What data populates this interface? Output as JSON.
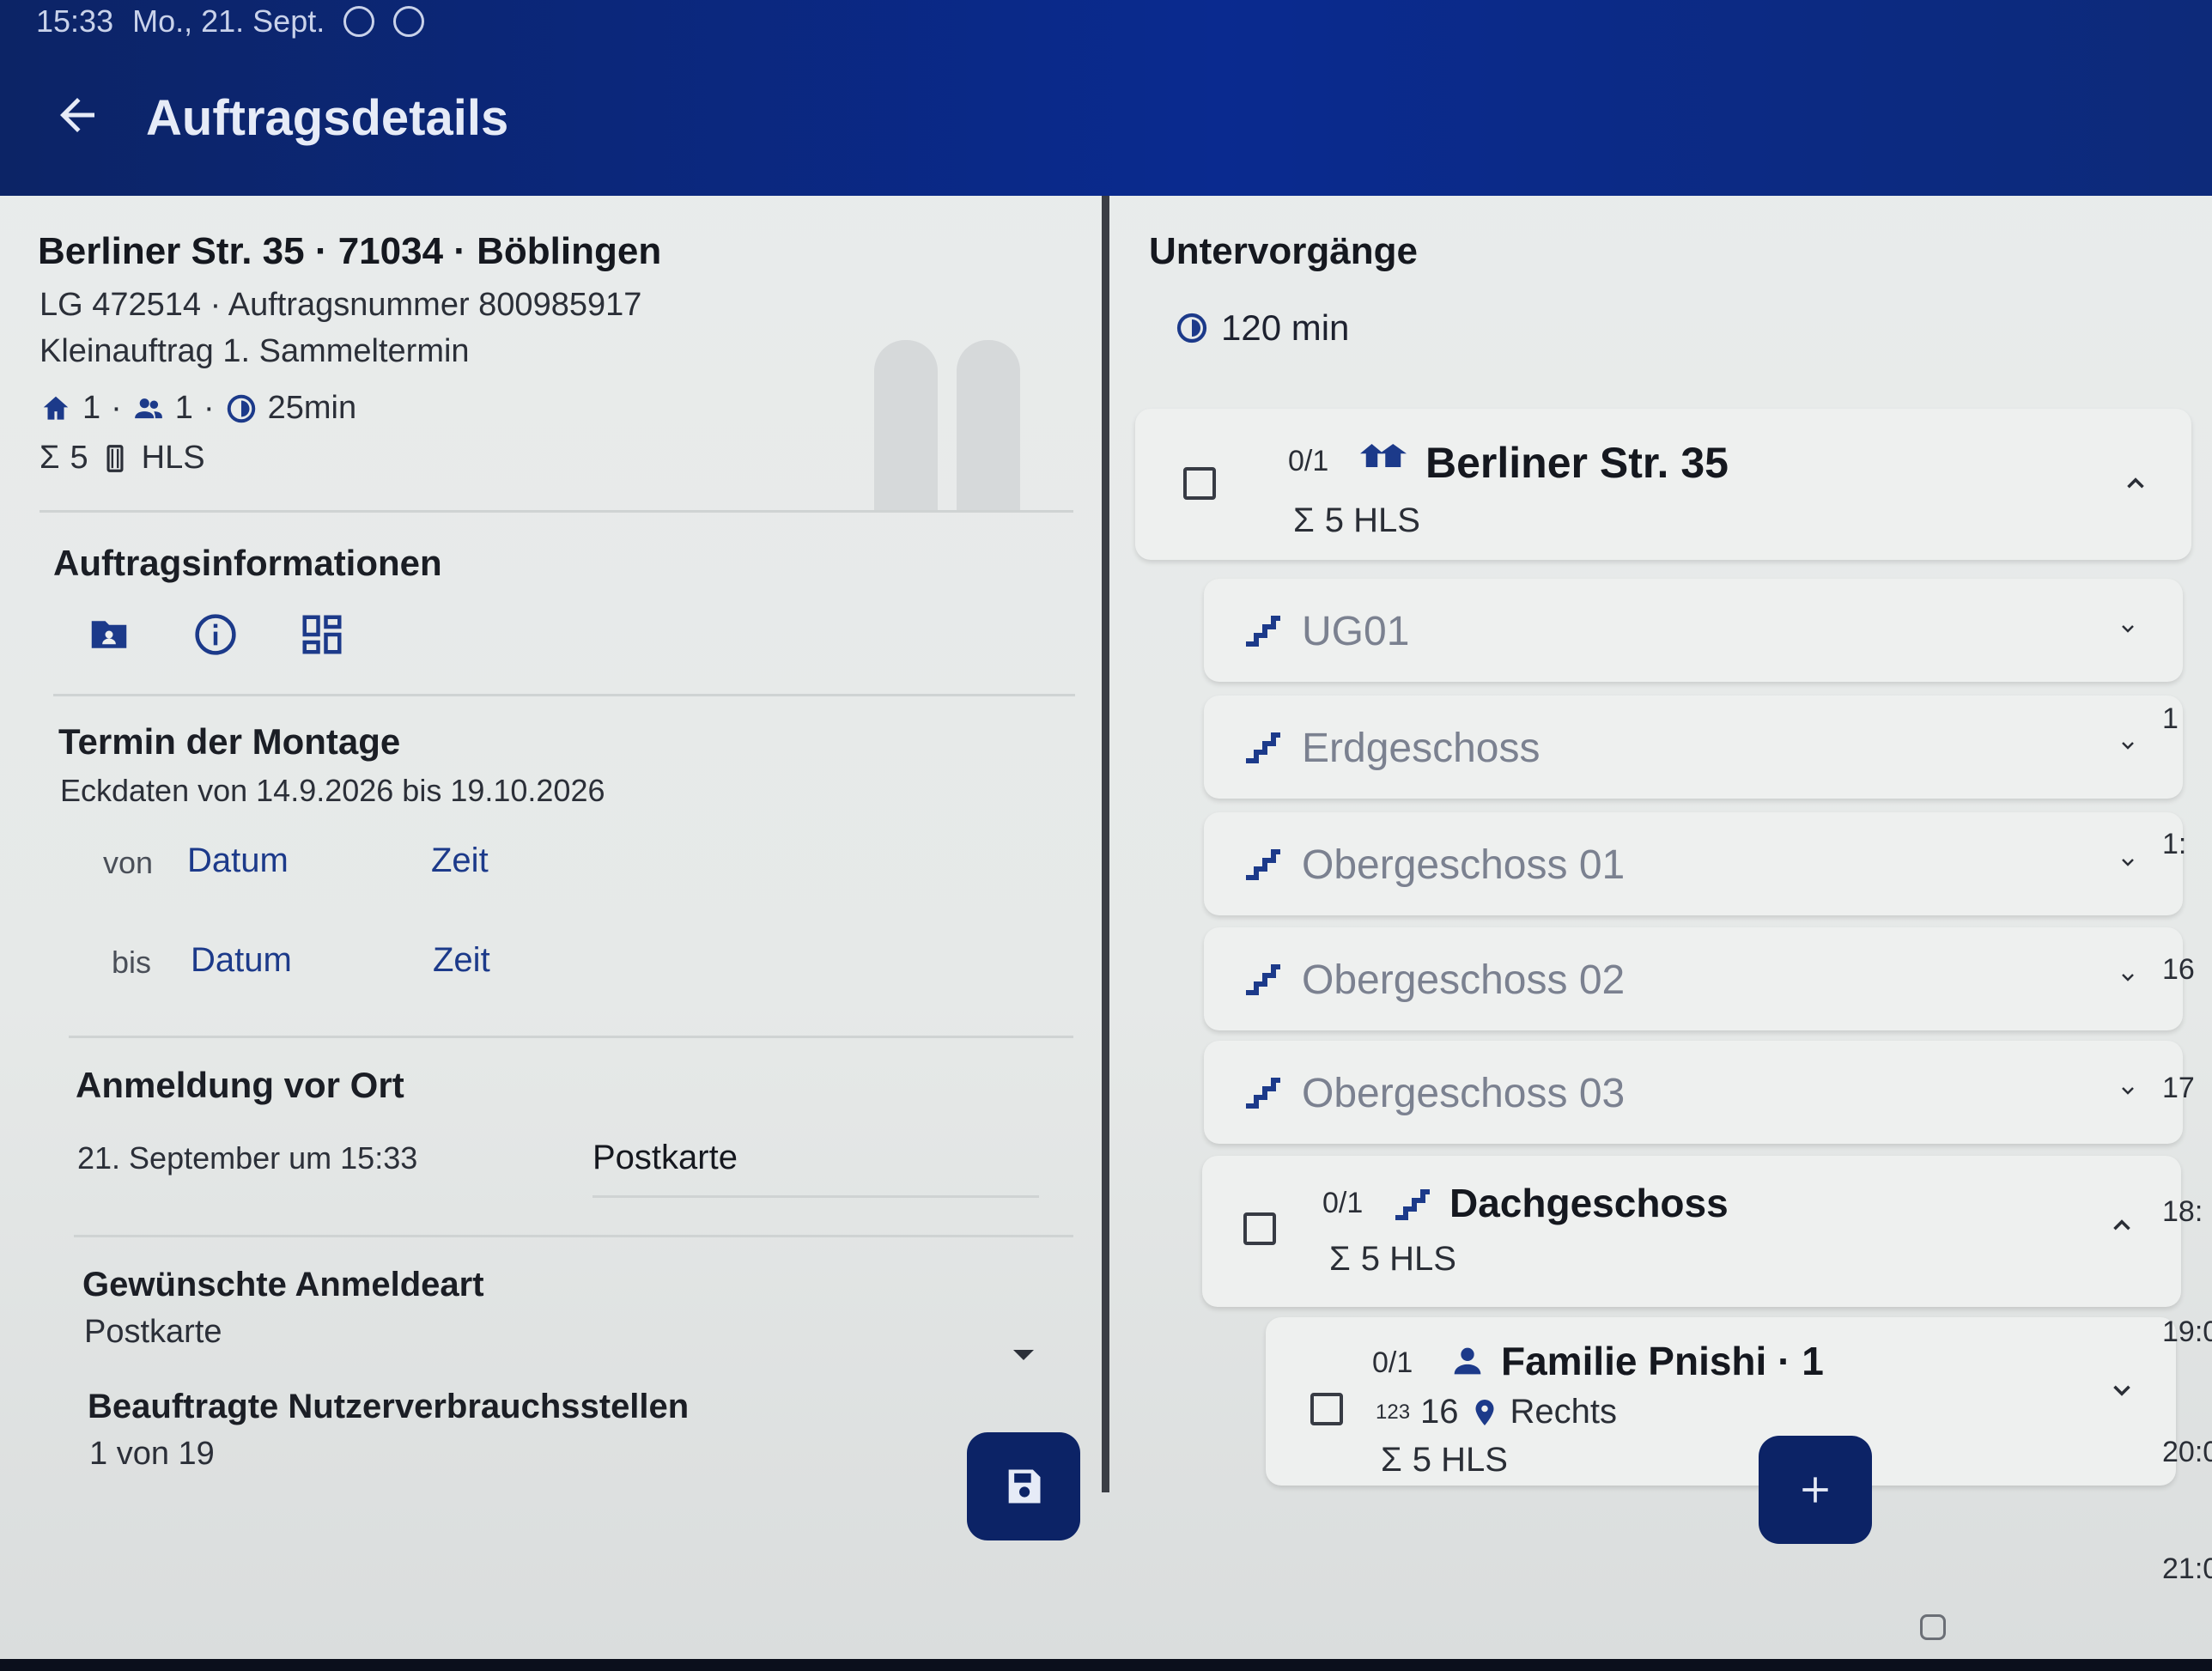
{
  "status": {
    "time": "15:33",
    "date": "Mo., 21. Sept."
  },
  "appbar": {
    "title": "Auftragsdetails"
  },
  "left": {
    "address_title": "Berliner Str. 35 · 71034 · Böblingen",
    "meta1": "LG 472514 · Auftragsnummer 800985917",
    "meta2": "Kleinauftrag 1. Sammeltermin",
    "stats": {
      "a": "1",
      "b": "1",
      "duration": "25min",
      "sum": "5",
      "unit": "HLS"
    },
    "section_info": "Auftragsinformationen",
    "section_termin": "Termin der Montage",
    "eckdaten": "Eckdaten von 14.9.2026 bis 19.10.2026",
    "von": "von",
    "bis": "bis",
    "datum": "Datum",
    "zeit": "Zeit",
    "section_anmeldung": "Anmeldung vor Ort",
    "anmeldung_date": "21. September um 15:33",
    "anmeldung_select": "Postkarte",
    "gewuenschte_label": "Gewünschte Anmeldeart",
    "gewuenschte_value": "Postkarte",
    "beauftragte_label": "Beauftragte Nutzerverbrauchsstellen",
    "beauftragte_value": "1 von 19"
  },
  "right": {
    "title": "Untervorgänge",
    "duration": "120 min",
    "top_card": {
      "count": "0/1",
      "title": "Berliner Str. 35",
      "sum": "5 HLS"
    },
    "floors": [
      "UG01",
      "Erdgeschoss",
      "Obergeschoss 01",
      "Obergeschoss 02",
      "Obergeschoss 03"
    ],
    "dach": {
      "count": "0/1",
      "title": "Dachgeschoss",
      "sum": "5 HLS"
    },
    "familie": {
      "count": "0/1",
      "title": "Familie Pnishi · 1",
      "number": "16",
      "location": "Rechts",
      "sum": "5 HLS"
    }
  },
  "timeline": [
    "1",
    "1:",
    "16",
    "17",
    "18:",
    "19:0",
    "20:0",
    "21:0"
  ]
}
